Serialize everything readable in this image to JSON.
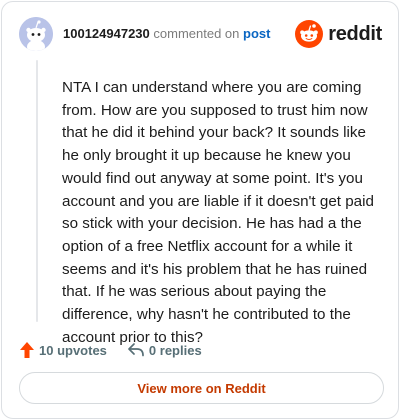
{
  "header": {
    "username": "100124947230",
    "action_text": "commented on",
    "post_link_label": "post",
    "brand_name": "reddit"
  },
  "comment": {
    "body": "NTA I can understand where you are coming from. How are you supposed to trust him now that he did it behind your back? It sounds like he only brought it up because he knew you would find out anyway at some point. It's you account and you are liable if it doesn't get paid so stick with your decision. He has had a the option of a free Netflix account for a while it seems and it's his problem that he has ruined that. If he was serious about paying the difference, why hasn't he contributed to the account prior to this?"
  },
  "stats": {
    "upvotes_label": "10 upvotes",
    "replies_label": "0 replies"
  },
  "footer": {
    "view_more_label": "View more on Reddit"
  },
  "icons": {
    "avatar": "snoo-avatar-icon",
    "brand": "reddit-logo-icon",
    "upvote": "upvote-arrow-icon",
    "reply": "reply-arrow-icon"
  },
  "colors": {
    "brand_orange": "#ff4500",
    "link_blue": "#0a66c2",
    "upvote_orange": "#ff4500",
    "view_more_text": "#c43a00"
  }
}
